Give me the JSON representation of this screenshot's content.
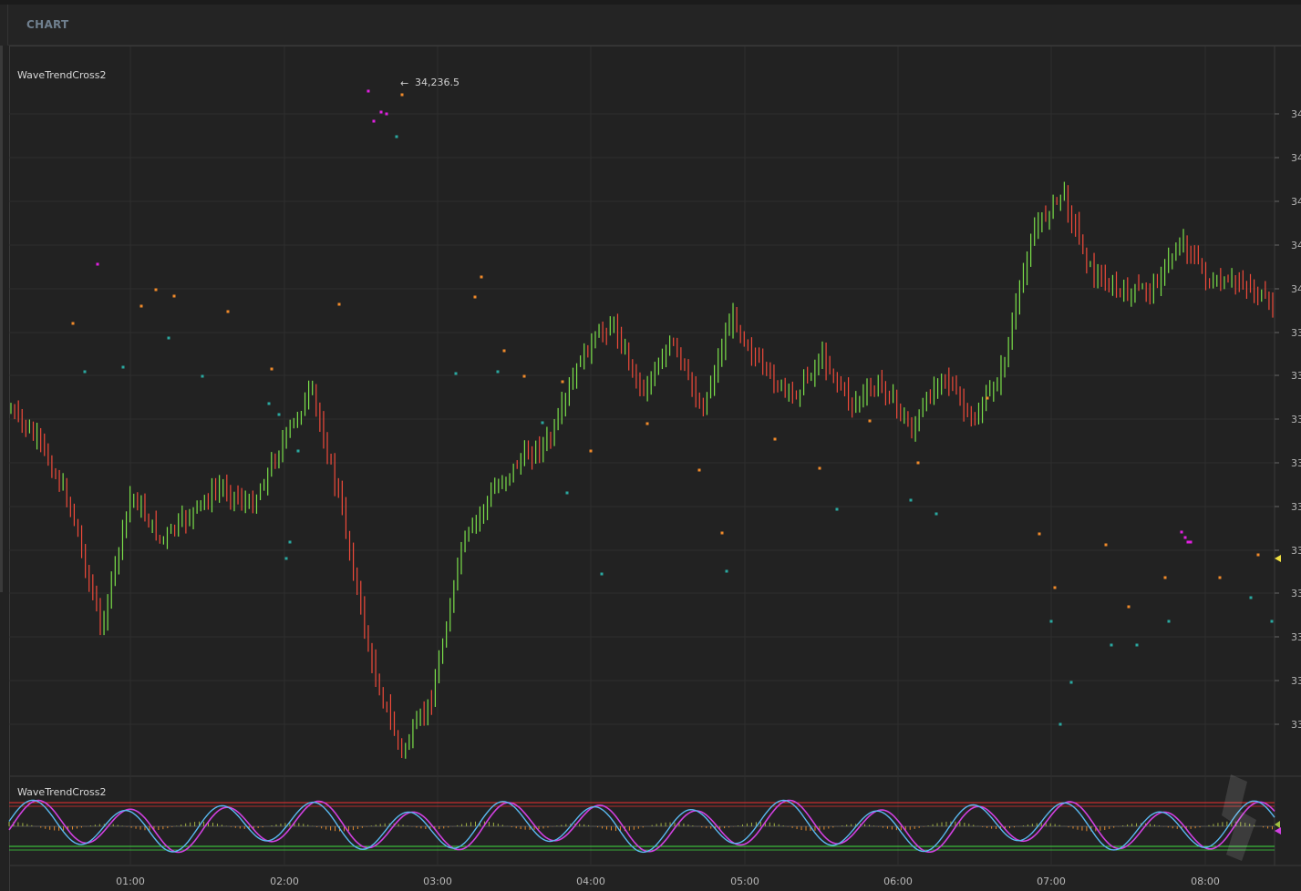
{
  "header": {
    "title": "CHART"
  },
  "price_pane": {
    "study_label": "WaveTrendCross2",
    "high_marker": "34,236.5",
    "y_axis_labels": [
      "34",
      "34",
      "34",
      "34",
      "34",
      "33",
      "33",
      "33",
      "33",
      "33",
      "33",
      "33",
      "33",
      "33",
      "33"
    ]
  },
  "osc_pane": {
    "study_label": "WaveTrendCross2"
  },
  "x_axis": {
    "labels": [
      "01:00",
      "02:00",
      "03:00",
      "04:00",
      "05:00",
      "06:00",
      "07:00",
      "08:00"
    ]
  },
  "colors": {
    "up": "#7be04a",
    "down": "#f04a3a",
    "buy_dot": "#f08a2a",
    "sell_dot": "#e020e0",
    "low_dot": "#2aa8a0",
    "wt1": "#5ab8f0",
    "wt2": "#d040e0",
    "ob_line": "#f03030",
    "os_line": "#40e040",
    "grid": "#2e2e2e"
  },
  "chart_data": {
    "type": "ohlc",
    "title": "",
    "x_labels": [
      "01:00",
      "02:00",
      "03:00",
      "04:00",
      "05:00",
      "06:00",
      "07:00",
      "08:00"
    ],
    "price_high": "34,236.5",
    "closes_shape": [
      0.52,
      0.47,
      0.38,
      0.2,
      0.4,
      0.33,
      0.37,
      0.41,
      0.38,
      0.47,
      0.55,
      0.38,
      0.15,
      0.02,
      0.1,
      0.32,
      0.4,
      0.45,
      0.48,
      0.6,
      0.65,
      0.55,
      0.62,
      0.52,
      0.66,
      0.58,
      0.54,
      0.6,
      0.53,
      0.56,
      0.49,
      0.58,
      0.5,
      0.58,
      0.78,
      0.84,
      0.72,
      0.69,
      0.7,
      0.77,
      0.7,
      0.71,
      0.67
    ],
    "oscillator": {
      "series": [
        "wt1",
        "wt2"
      ],
      "overbought": 60,
      "oversold": -60
    }
  }
}
